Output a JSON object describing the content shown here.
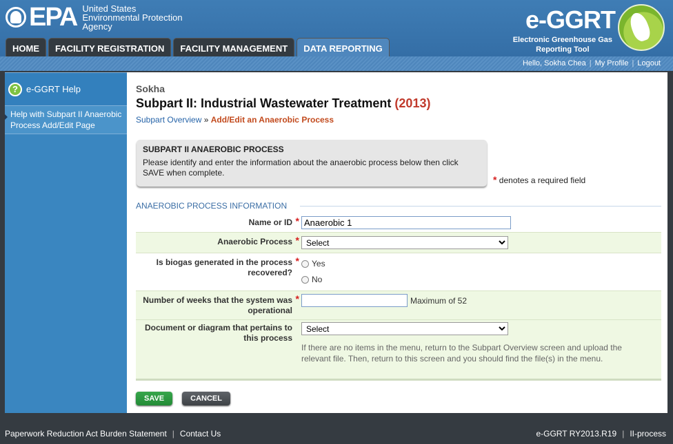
{
  "header": {
    "epa_logo_text": "EPA",
    "agency_lines": [
      "United States",
      "Environmental Protection",
      "Agency"
    ],
    "app_title": "e-GGRT",
    "app_subtitle_lines": [
      "Electronic Greenhouse Gas",
      "Reporting Tool"
    ]
  },
  "nav_tabs": [
    {
      "label": "HOME",
      "active": false
    },
    {
      "label": "FACILITY REGISTRATION",
      "active": false
    },
    {
      "label": "FACILITY MANAGEMENT",
      "active": false
    },
    {
      "label": "DATA REPORTING",
      "active": true
    }
  ],
  "user_bar": {
    "greeting": "Hello, Sokha Chea",
    "profile": "My Profile",
    "logout": "Logout"
  },
  "sidebar": {
    "help_label": "e-GGRT Help",
    "help_link": "Help with Subpart II Anaerobic Process Add/Edit Page"
  },
  "page": {
    "facility": "Sokha",
    "title": "Subpart II: Industrial Wastewater Treatment",
    "year": "(2013)",
    "breadcrumb_link": "Subpart Overview",
    "breadcrumb_sep": "»",
    "breadcrumb_current": "Add/Edit an Anaerobic Process"
  },
  "instruction": {
    "title": "SUBPART II ANAEROBIC PROCESS",
    "text": "Please identify and enter the information about the anaerobic process below then click SAVE when complete."
  },
  "required_note": "denotes a required field",
  "section_title": "ANAEROBIC PROCESS INFORMATION",
  "form": {
    "name_label": "Name or ID",
    "name_value": "Anaerobic 1",
    "process_label": "Anaerobic Process",
    "process_selected": "Select",
    "biogas_label": "Is biogas generated in the process recovered?",
    "biogas_yes": "Yes",
    "biogas_no": "No",
    "weeks_label": "Number of weeks that the system was operational",
    "weeks_value": "",
    "weeks_hint": "Maximum of 52",
    "doc_label": "Document or diagram that pertains to this process",
    "doc_selected": "Select",
    "doc_help": "If there are no items in the menu, return to the Subpart Overview screen and upload the relevant file. Then, return to this screen and you should find the file(s) in the menu."
  },
  "buttons": {
    "save": "SAVE",
    "cancel": "CANCEL"
  },
  "footer": {
    "paperwork": "Paperwork Reduction Act Burden Statement",
    "contact": "Contact Us",
    "version": "e-GGRT RY2013.R19",
    "page_code": "II-process"
  }
}
